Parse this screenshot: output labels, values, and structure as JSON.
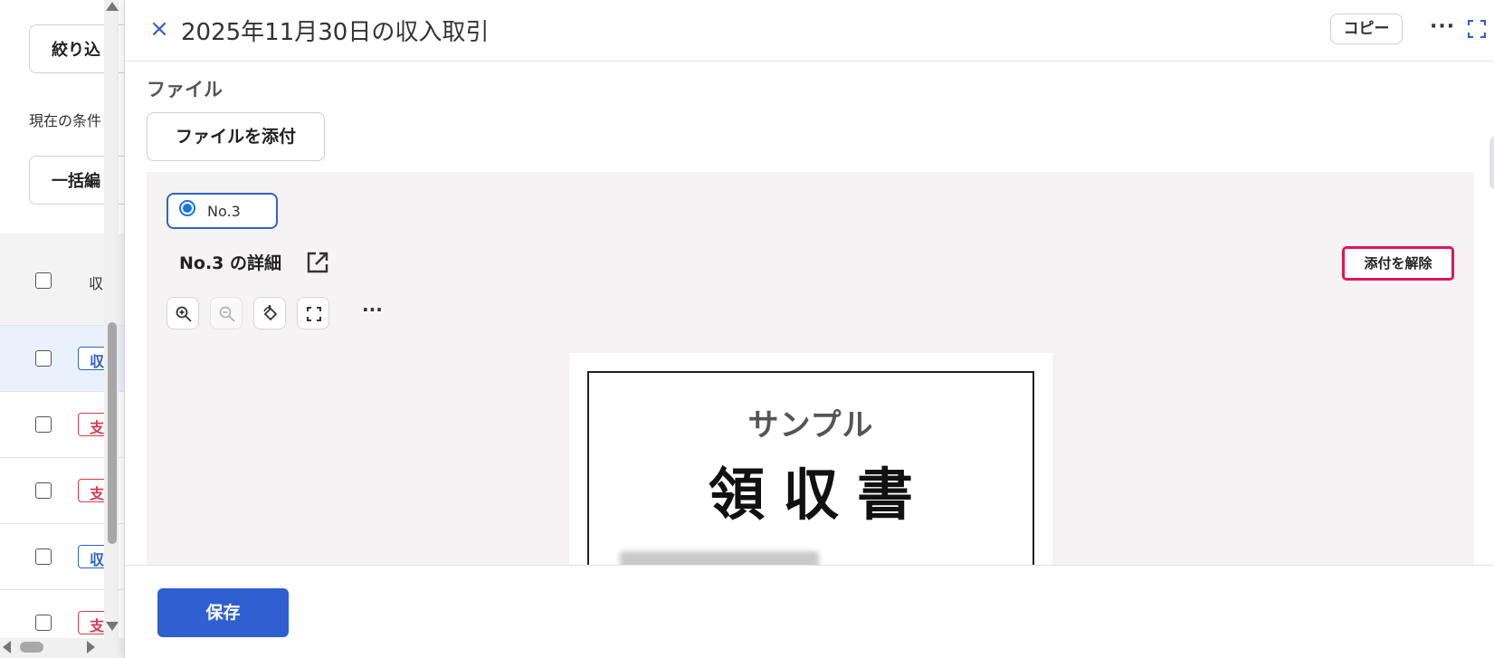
{
  "left_pane": {
    "filter_button": "絞り込",
    "current_conditions": "現在の条件",
    "bulk_edit_button": "一括編",
    "header_col": "収",
    "rows": [
      {
        "type": "in",
        "tag": "収",
        "selected": true
      },
      {
        "type": "out",
        "tag": "支",
        "selected": false
      },
      {
        "type": "out",
        "tag": "支",
        "selected": false
      },
      {
        "type": "in",
        "tag": "収",
        "selected": false
      },
      {
        "type": "out",
        "tag": "支",
        "selected": false
      }
    ]
  },
  "panel": {
    "close_icon": "×",
    "title": "2025年11月30日の収入取引",
    "copy_button": "コピー",
    "more_icon": "···",
    "section_label": "ファイル",
    "attach_button": "ファイルを添付",
    "attachment": {
      "radio_label": "No.3",
      "detail_title": "No.3 の詳細",
      "detach_button": "添付を解除",
      "more_tools": "···",
      "receipt": {
        "sample_label": "サンプル",
        "heading": "領収書"
      }
    },
    "save_button": "保存"
  },
  "colors": {
    "primary": "#2f5fd0",
    "income_tag": "#2f64c8",
    "expense_tag": "#d93a4a",
    "highlight": "#e0145f"
  }
}
